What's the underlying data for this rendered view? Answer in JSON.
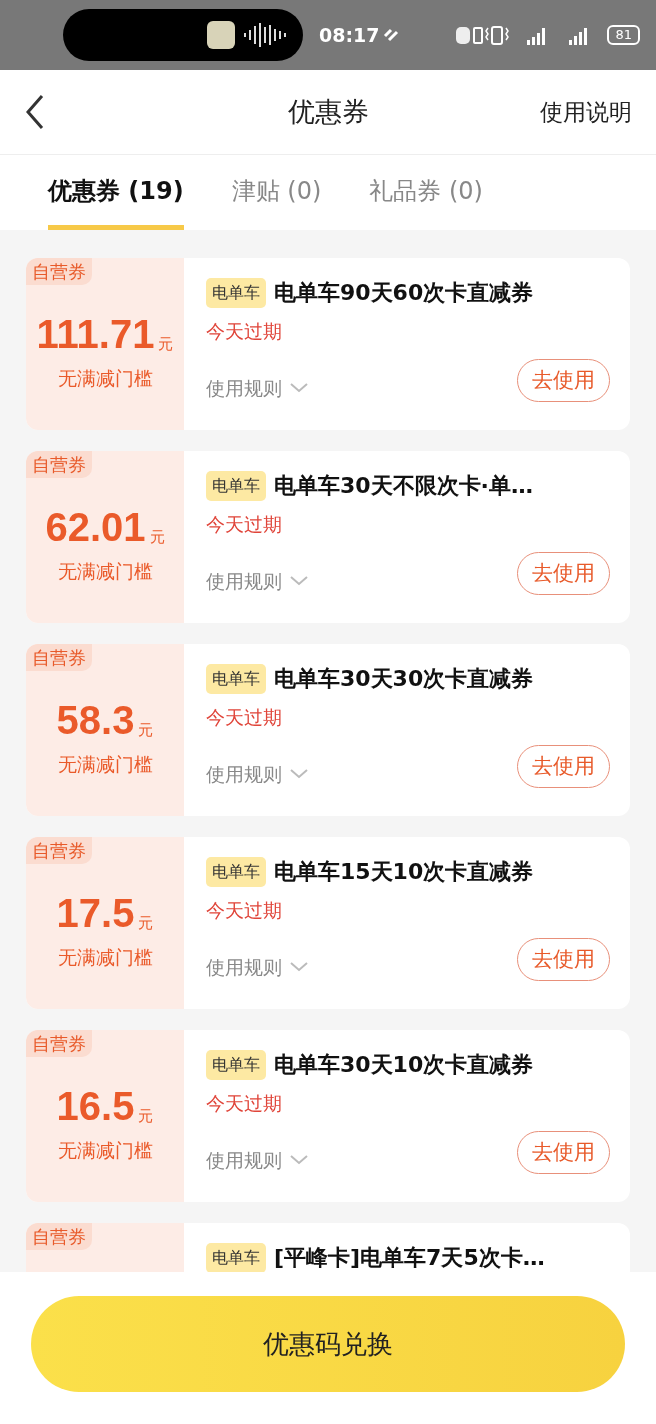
{
  "status_bar": {
    "time": "08:17",
    "battery": "81"
  },
  "header": {
    "title": "优惠券",
    "help_link": "使用说明"
  },
  "tabs": [
    {
      "label": "优惠券 (19)",
      "selected": true
    },
    {
      "label": "津贴 (0)",
      "selected": false
    },
    {
      "label": "礼品券 (0)",
      "selected": false
    }
  ],
  "coupons": [
    {
      "source": "自营券",
      "amount": "111.71",
      "unit": "元",
      "threshold": "无满减门槛",
      "tag": "电单车",
      "title": "电单车90天60次卡直减券",
      "expiry": "今天过期",
      "rules": "使用规则",
      "action": "去使用"
    },
    {
      "source": "自营券",
      "amount": "62.01",
      "unit": "元",
      "threshold": "无满减门槛",
      "tag": "电单车",
      "title": "电单车30天不限次卡·单…",
      "expiry": "今天过期",
      "rules": "使用规则",
      "action": "去使用"
    },
    {
      "source": "自营券",
      "amount": "58.3",
      "unit": "元",
      "threshold": "无满减门槛",
      "tag": "电单车",
      "title": "电单车30天30次卡直减券",
      "expiry": "今天过期",
      "rules": "使用规则",
      "action": "去使用"
    },
    {
      "source": "自营券",
      "amount": "17.5",
      "unit": "元",
      "threshold": "无满减门槛",
      "tag": "电单车",
      "title": "电单车15天10次卡直减券",
      "expiry": "今天过期",
      "rules": "使用规则",
      "action": "去使用"
    },
    {
      "source": "自营券",
      "amount": "16.5",
      "unit": "元",
      "threshold": "无满减门槛",
      "tag": "电单车",
      "title": "电单车30天10次卡直减券",
      "expiry": "今天过期",
      "rules": "使用规则",
      "action": "去使用"
    },
    {
      "source": "自营券",
      "tag": "电单车",
      "title": "[平峰卡]电单车7天5次卡…"
    }
  ],
  "redeem_button": "优惠码兑换"
}
